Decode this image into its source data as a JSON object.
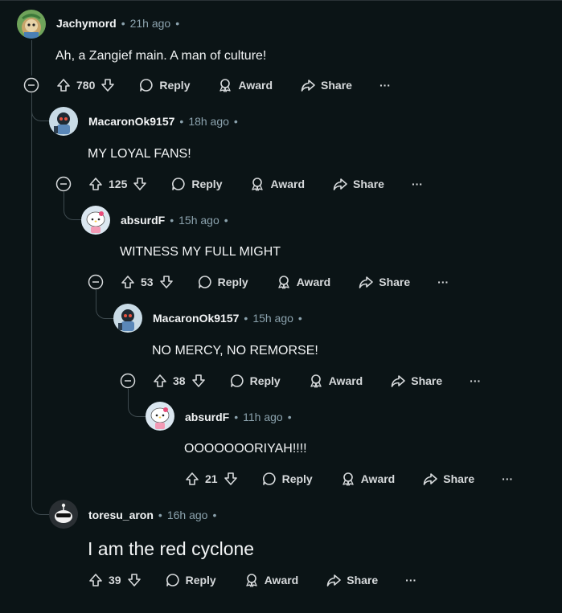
{
  "comments": [
    {
      "user": "Jachymord",
      "time": "21h ago",
      "text": "Ah, a Zangief main. A man of culture!",
      "votes": "780"
    },
    {
      "user": "MacaronOk9157",
      "time": "18h ago",
      "text": "MY LOYAL FANS!",
      "votes": "125"
    },
    {
      "user": "absurdF",
      "time": "15h ago",
      "text": "WITNESS MY FULL MIGHT",
      "votes": "53"
    },
    {
      "user": "MacaronOk9157",
      "time": "15h ago",
      "text": "NO MERCY, NO REMORSE!",
      "votes": "38"
    },
    {
      "user": "absurdF",
      "time": "11h ago",
      "text": "OOOOOOORIYAH!!!!",
      "votes": "21"
    },
    {
      "user": "toresu_aron",
      "time": "16h ago",
      "text": "I am the red cyclone",
      "votes": "39"
    }
  ],
  "labels": {
    "dot": "•",
    "reply": "Reply",
    "award": "Award",
    "share": "Share",
    "more": "···"
  },
  "icons": [
    "collapse-icon",
    "upvote-icon",
    "downvote-icon",
    "reply-icon",
    "award-icon",
    "share-icon",
    "more-icon"
  ],
  "colors": {
    "background": "#0b1416",
    "text": "#d7dadc",
    "muted": "#8ba2ad",
    "line": "#3e4a4f"
  }
}
